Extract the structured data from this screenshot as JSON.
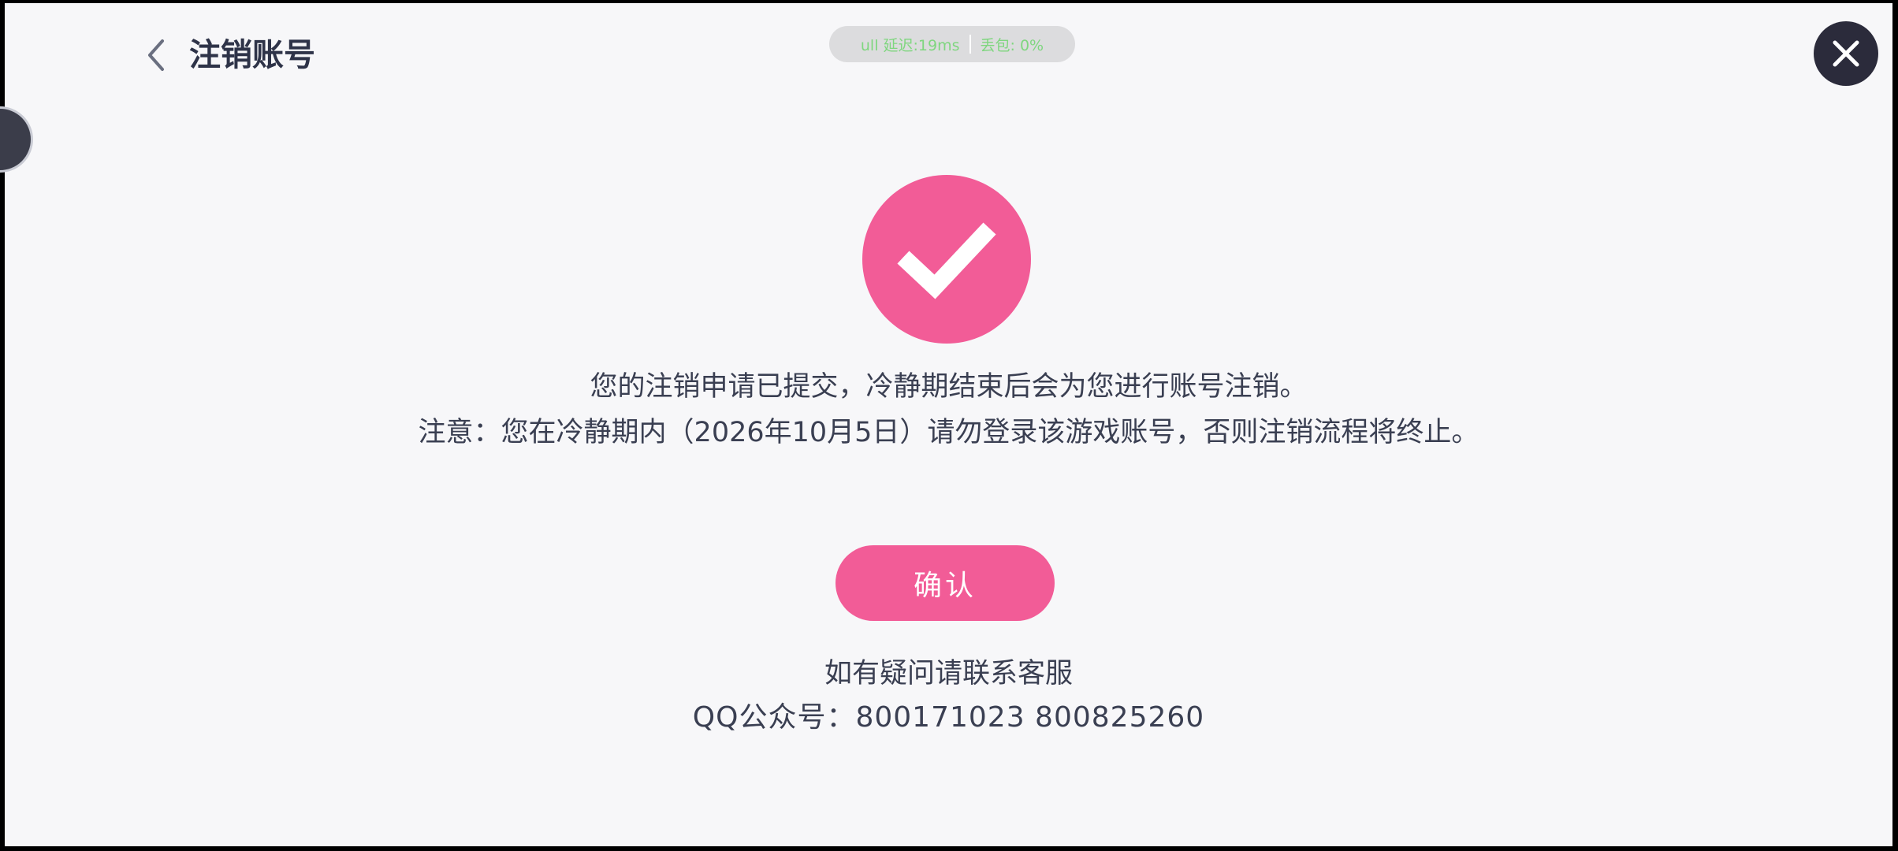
{
  "header": {
    "title": "注销账号",
    "back_icon": "chevron-left-icon"
  },
  "status_bar": {
    "latency": "ull 延迟:19ms",
    "packet_loss": "丢包: 0%",
    "color": "#7fd67f"
  },
  "close_icon": "close-icon",
  "result": {
    "icon": "checkmark-icon",
    "accent_color": "#f25c97",
    "message": "您的注销申请已提交，冷静期结束后会为您进行账号注销。",
    "notice": "注意：您在冷静期内（2026年10月5日）请勿登录该游戏账号，否则注销流程将终止。"
  },
  "confirm_button": {
    "label": "确认"
  },
  "support": {
    "line1": "如有疑问请联系客服",
    "line2": "QQ公众号：800171023 800825260"
  }
}
